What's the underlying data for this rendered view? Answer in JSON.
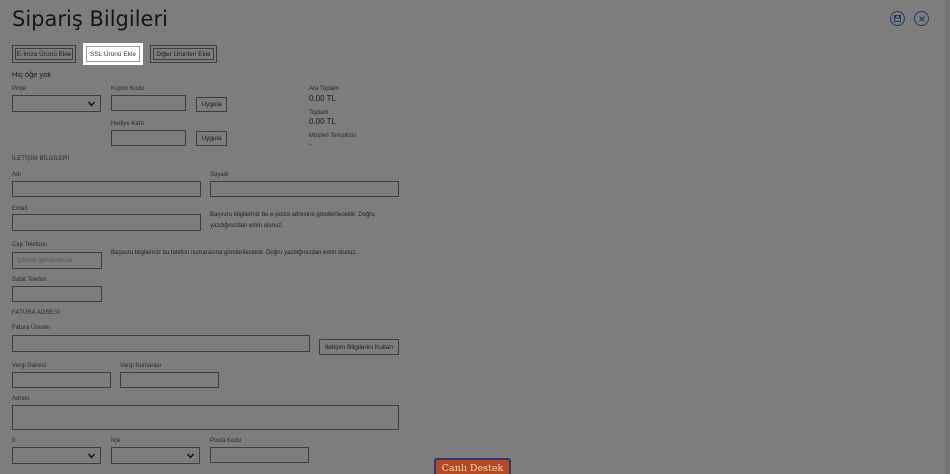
{
  "header": {
    "title": "Sipariş Bilgileri",
    "icons": [
      "save-icon",
      "close-icon"
    ]
  },
  "toolbar": {
    "esign_label": "E-İmza Ürünü Ekle",
    "ssl_label": "SSL Ürünü Ekle",
    "other_label": "Diğer Ürünleri Ekle"
  },
  "cart": {
    "empty_text": "Hiç öğe yok"
  },
  "order": {
    "project_label": "Proje",
    "coupon_label": "Kupon Kodu",
    "coupon_value": "",
    "apply_label": "Uygula",
    "giftcard_label": "Hediye Kartı",
    "giftcard_value": ""
  },
  "totals": {
    "subtotal_label": "Ara Toplam",
    "subtotal_value": "0.00 TL",
    "total_label": "Toplam",
    "total_value": "0.00 TL",
    "rep_label": "Müşteri Temsilcisi",
    "rep_value": "-"
  },
  "contact": {
    "section_title": "İLETİŞİM BİLGİLERİ",
    "first_name_label": "Adı",
    "last_name_label": "Soyadı",
    "email_label": "Email",
    "email_note": "Başvuru bilgileriniz bu e-posta adresine gönderilecektir. Doğru yazdığınızdan emin olunuz.",
    "mobile_label": "Cep Telefonu",
    "mobile_placeholder": "Şifreniz gönderilecek",
    "mobile_note": "Başvuru bilgileriniz bu telefon numarasına gönderilecektir. Doğru yazdığınızdan emin olunuz.",
    "phone_label": "Sabit Telefon"
  },
  "billing": {
    "section_title": "FATURA ADRESİ",
    "title_label": "Fatura Ünvanı",
    "use_contact_label": "İletişim Bilgilerini Kullan",
    "tax_office_label": "Vergi Dairesi",
    "tax_number_label": "Vergi Numarası",
    "address_label": "Adresi",
    "city_label": "İl",
    "district_label": "İlçe",
    "postcode_label": "Posta Kodu"
  },
  "support": {
    "label": "Canlı Destek"
  },
  "colors": {
    "overlay": "#7d7d7d",
    "icon": "#223a5c",
    "support_bg": "#b8491d",
    "support_border": "#283a78"
  }
}
